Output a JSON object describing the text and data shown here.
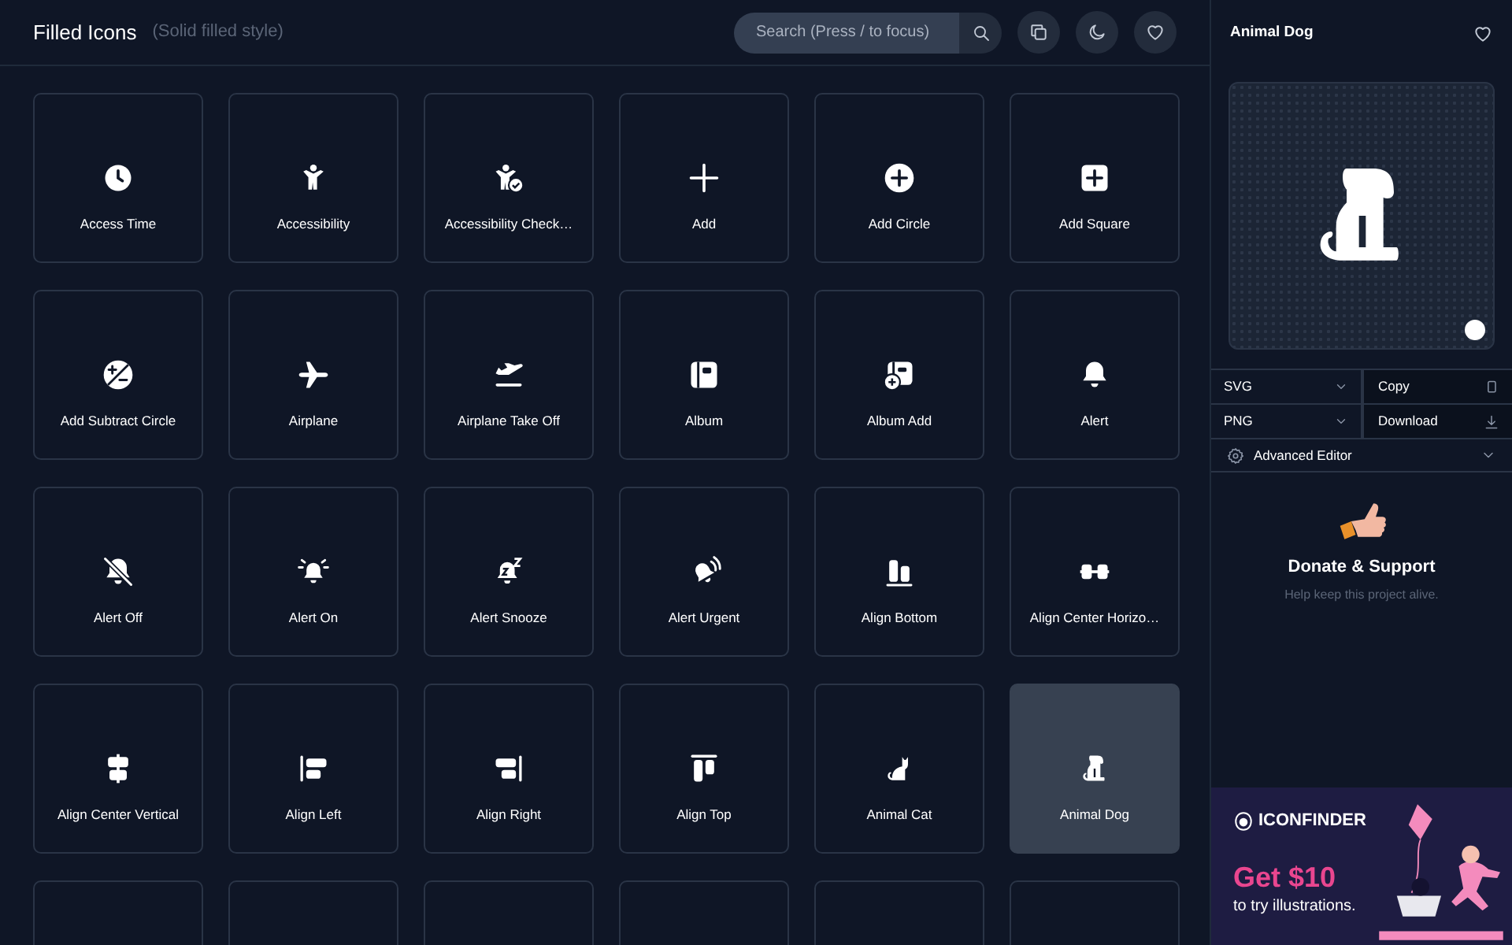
{
  "header": {
    "title": "Filled Icons",
    "subtitle": "(Solid filled style)",
    "search": {
      "placeholder": "Search (Press / to focus)"
    }
  },
  "icons": [
    {
      "label": "Access Time",
      "selected": false
    },
    {
      "label": "Accessibility",
      "selected": false
    },
    {
      "label": "Accessibility Check…",
      "selected": false
    },
    {
      "label": "Add",
      "selected": false
    },
    {
      "label": "Add Circle",
      "selected": false
    },
    {
      "label": "Add Square",
      "selected": false
    },
    {
      "label": "Add Subtract Circle",
      "selected": false
    },
    {
      "label": "Airplane",
      "selected": false
    },
    {
      "label": "Airplane Take Off",
      "selected": false
    },
    {
      "label": "Album",
      "selected": false
    },
    {
      "label": "Album Add",
      "selected": false
    },
    {
      "label": "Alert",
      "selected": false
    },
    {
      "label": "Alert Off",
      "selected": false
    },
    {
      "label": "Alert On",
      "selected": false
    },
    {
      "label": "Alert Snooze",
      "selected": false
    },
    {
      "label": "Alert Urgent",
      "selected": false
    },
    {
      "label": "Align Bottom",
      "selected": false
    },
    {
      "label": "Align Center Horizo…",
      "selected": false
    },
    {
      "label": "Align Center Vertical",
      "selected": false
    },
    {
      "label": "Align Left",
      "selected": false
    },
    {
      "label": "Align Right",
      "selected": false
    },
    {
      "label": "Align Top",
      "selected": false
    },
    {
      "label": "Animal Cat",
      "selected": false
    },
    {
      "label": "Animal Dog",
      "selected": true
    },
    {
      "selected": false
    },
    {
      "selected": false
    },
    {
      "selected": false
    },
    {
      "selected": false
    },
    {
      "selected": false
    },
    {
      "selected": false
    }
  ],
  "detail": {
    "title": "Animal Dog",
    "format_rows": [
      {
        "format": "SVG",
        "action": "Copy"
      },
      {
        "format": "PNG",
        "action": "Download"
      }
    ],
    "advanced": {
      "label": "Advanced Editor",
      "expanded": false
    },
    "donate": {
      "title": "Donate & Support",
      "text": "Help keep this project alive."
    }
  },
  "ad": {
    "brand": "ICONFINDER",
    "headline": "Get $10",
    "text": "to try illustrations."
  }
}
